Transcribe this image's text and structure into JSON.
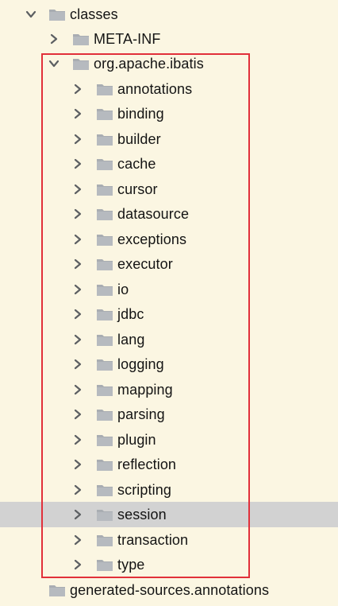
{
  "tree": {
    "root": {
      "label": "classes",
      "expanded": true,
      "icon": "folder-icon"
    },
    "meta_inf": {
      "label": "META-INF",
      "expanded": false,
      "icon": "folder-icon"
    },
    "package": {
      "label": "org.apache.ibatis",
      "expanded": true,
      "icon": "folder-icon"
    },
    "children": [
      {
        "label": "annotations",
        "selected": false
      },
      {
        "label": "binding",
        "selected": false
      },
      {
        "label": "builder",
        "selected": false
      },
      {
        "label": "cache",
        "selected": false
      },
      {
        "label": "cursor",
        "selected": false
      },
      {
        "label": "datasource",
        "selected": false
      },
      {
        "label": "exceptions",
        "selected": false
      },
      {
        "label": "executor",
        "selected": false
      },
      {
        "label": "io",
        "selected": false
      },
      {
        "label": "jdbc",
        "selected": false
      },
      {
        "label": "lang",
        "selected": false
      },
      {
        "label": "logging",
        "selected": false
      },
      {
        "label": "mapping",
        "selected": false
      },
      {
        "label": "parsing",
        "selected": false
      },
      {
        "label": "plugin",
        "selected": false
      },
      {
        "label": "reflection",
        "selected": false
      },
      {
        "label": "scripting",
        "selected": false
      },
      {
        "label": "session",
        "selected": true
      },
      {
        "label": "transaction",
        "selected": false
      },
      {
        "label": "type",
        "selected": false
      }
    ],
    "generated": {
      "label": "generated-sources.annotations",
      "icon": "folder-icon"
    }
  },
  "colors": {
    "background": "#fbf6e2",
    "selection": "#d2d2d2",
    "highlight_border": "#e1303a",
    "folder": "#a9adb2",
    "chevron": "#5c5f62"
  }
}
